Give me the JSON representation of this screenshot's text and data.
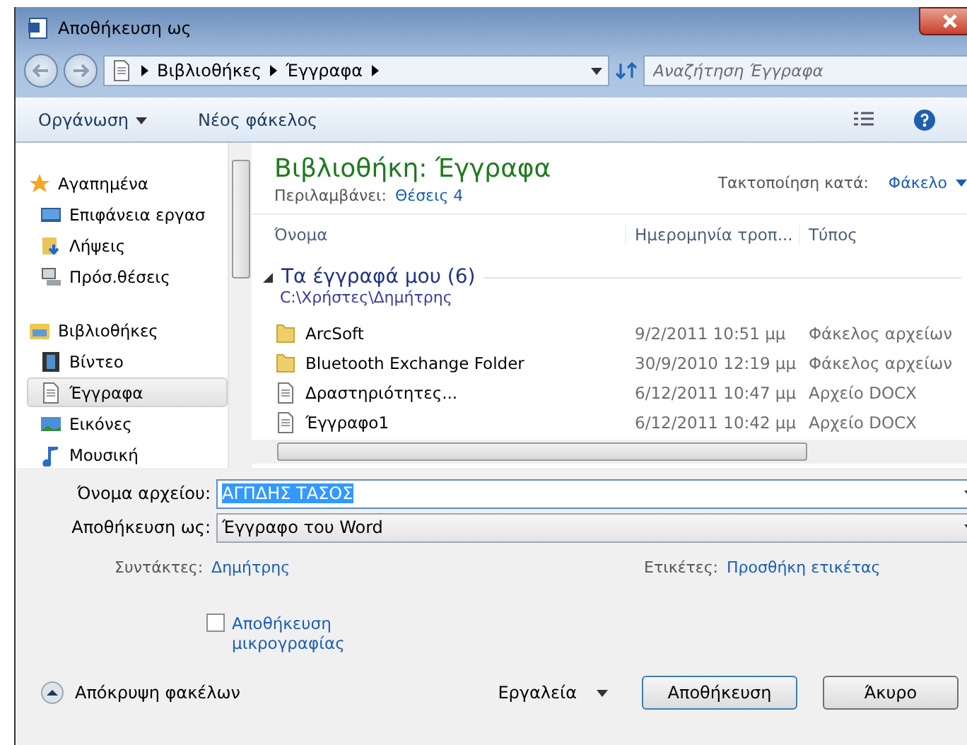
{
  "window": {
    "title": "Αποθήκευση ως"
  },
  "breadcrumb": [
    "Βιβλιοθήκες",
    "Έγγραφα"
  ],
  "search": {
    "placeholder": "Αναζήτηση Έγγραφα"
  },
  "toolbar": {
    "organize": "Οργάνωση",
    "new_folder": "Νέος φάκελος"
  },
  "sidebar": {
    "groups": [
      {
        "label": "Αγαπημένα",
        "kind": "star",
        "children": [
          {
            "label": "Επιφάνεια εργασ",
            "kind": "desktop",
            "selected": false
          },
          {
            "label": "Λήψεις",
            "kind": "download",
            "selected": false
          },
          {
            "label": "Πρόσ.θέσεις",
            "kind": "places",
            "selected": false
          }
        ]
      },
      {
        "label": "Βιβλιοθήκες",
        "kind": "library",
        "children": [
          {
            "label": "Βίντεο",
            "kind": "video",
            "selected": false
          },
          {
            "label": "Έγγραφα",
            "kind": "document",
            "selected": true
          },
          {
            "label": "Εικόνες",
            "kind": "image",
            "selected": false
          },
          {
            "label": "Μουσική",
            "kind": "music",
            "selected": false
          }
        ]
      }
    ]
  },
  "library": {
    "title": "Βιβλιοθήκη: Έγγραφα",
    "includes_label": "Περιλαμβάνει:",
    "includes_link": "Θέσεις 4",
    "arrange_label": "Τακτοποίηση κατά:",
    "arrange_value": "Φάκελο"
  },
  "table": {
    "columns": [
      "Όνομα",
      "Ημερομηνία τροπ...",
      "Τύπος"
    ],
    "group": {
      "title": "Τα έγγραφά μου (6)",
      "path": "C:\\Χρήστες\\Δημήτρης",
      "expanded": true
    },
    "rows": [
      {
        "kind": "folder",
        "name": "ArcSoft",
        "date": "9/2/2011 10:51 μμ",
        "type": "Φάκελος αρχείων"
      },
      {
        "kind": "folder",
        "name": "Bluetooth Exchange Folder",
        "date": "30/9/2010 12:19 μμ",
        "type": "Φάκελος αρχείων"
      },
      {
        "kind": "file",
        "name": "Δραστηριότητες...",
        "date": "6/12/2011 10:47 μμ",
        "type": "Αρχείο DOCX"
      },
      {
        "kind": "file",
        "name": "Έγγραφο1",
        "date": "6/12/2011 10:42 μμ",
        "type": "Αρχείο DOCX"
      }
    ]
  },
  "form": {
    "filename_label": "Όνομα αρχείου:",
    "filename": "ΑΓΠΔΗΣ ΤΑΣΟΣ",
    "type_label": "Αποθήκευση ως:",
    "type": "Έγγραφο του Word",
    "authors_label": "Συντάκτες:",
    "authors": "Δημήτρης",
    "tags_label": "Ετικέτες:",
    "tags": "Προσθήκη ετικέτας",
    "thumbnail": {
      "label": "Αποθήκευση μικρογραφίας",
      "checked": false
    }
  },
  "footer": {
    "hide_folders": "Απόκρυψη φακέλων",
    "tools": "Εργαλεία",
    "save": "Αποθήκευση",
    "cancel": "Άκυρο"
  }
}
